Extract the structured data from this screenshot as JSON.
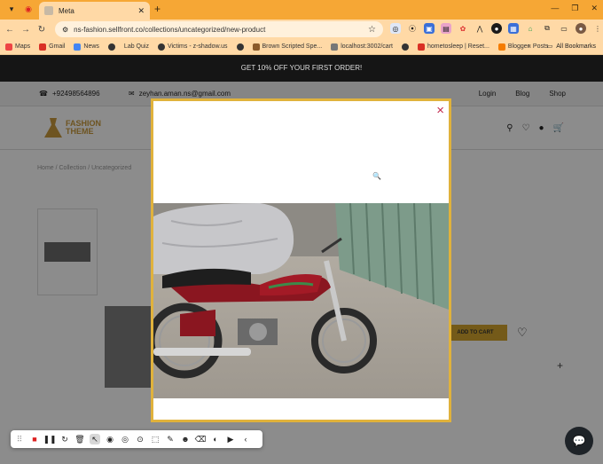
{
  "browser": {
    "tab_title": "Meta",
    "url": "ns-fashion.sellfront.co/collections/uncategorized/new-product",
    "bookmarks": [
      "Maps",
      "Gmail",
      "News",
      "",
      "Lab Quiz",
      "Victims - z-shadow.us",
      "",
      "Brown Scripted Spe...",
      "localhost:3002/cart",
      "",
      "hometosleep | Reset...",
      "Blogger: Posts"
    ],
    "all_bookmarks": "All Bookmarks",
    "more": "»"
  },
  "page": {
    "promo": "GET 10% OFF YOUR FIRST ORDER!",
    "phone": "+92498564896",
    "email": "zeyhan.aman.ns@gmail.com",
    "links": [
      "Login",
      "Blog",
      "Shop"
    ],
    "logo_line1": "FASHION",
    "logo_line2": "THEME",
    "breadcrumb": "Home  /  Collection  /  Uncategorized",
    "add_to_cart": "ADD TO CART"
  },
  "modal": {
    "close": "×"
  },
  "colors": {
    "tab_bar": "#f6a735",
    "modal_border": "#e0b23c",
    "close_icon": "#c22a4e",
    "promo_bg": "#151515"
  }
}
